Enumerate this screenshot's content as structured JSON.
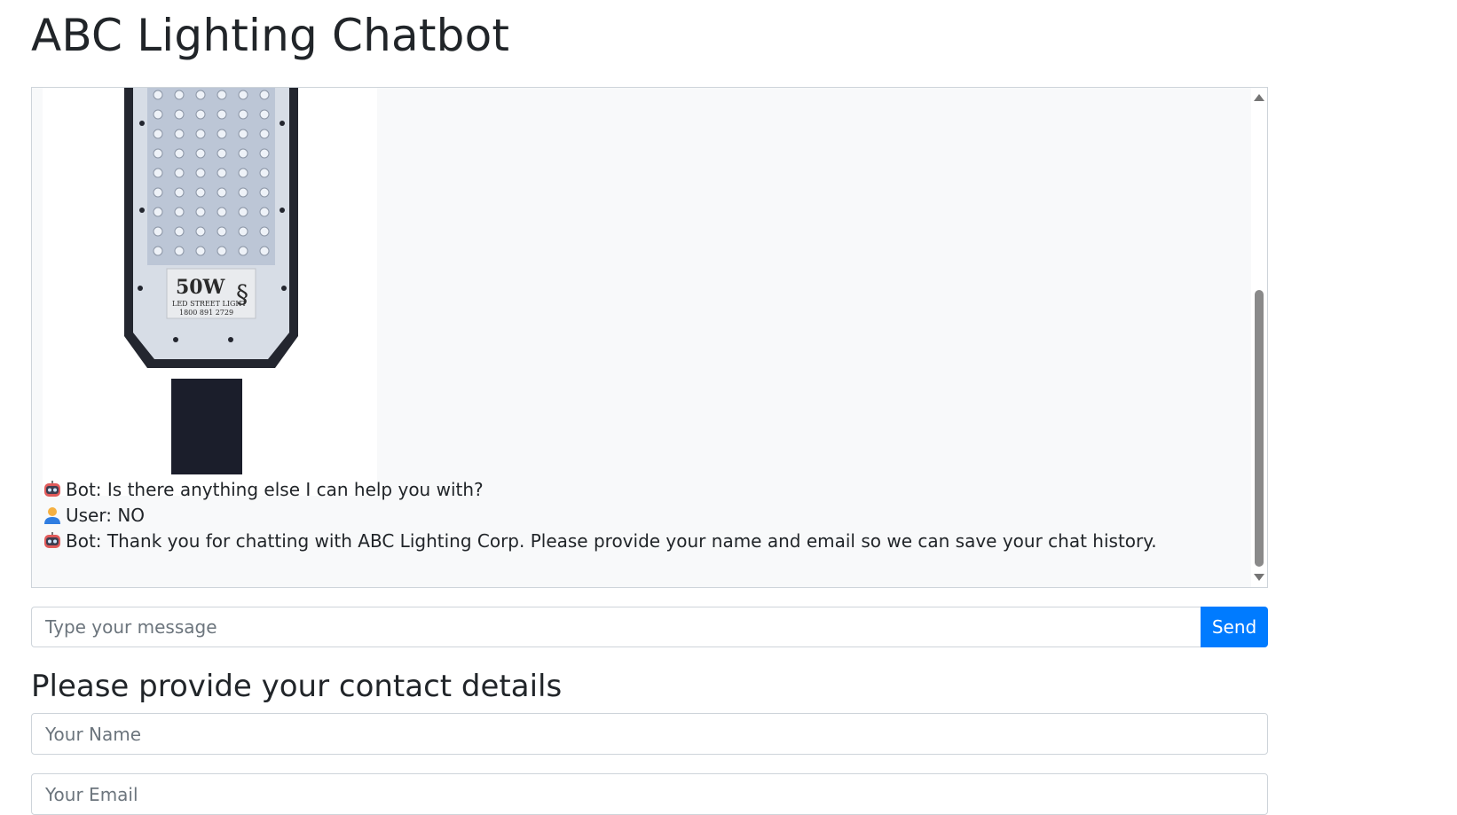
{
  "app": {
    "title": "ABC Lighting Chatbot"
  },
  "chat": {
    "product_image": {
      "label_main": "50W",
      "label_sub": "LED STREET LIGHT",
      "label_phone": "1800 891 2729"
    },
    "messages": [
      {
        "role": "bot",
        "avatar": "robot-icon",
        "text": "Bot: Is there anything else I can help you with?"
      },
      {
        "role": "user",
        "avatar": "person-icon",
        "text": "User: NO"
      },
      {
        "role": "bot",
        "avatar": "robot-icon",
        "text": "Bot: Thank you for chatting with ABC Lighting Corp. Please provide your name and email so we can save your chat history."
      }
    ]
  },
  "composer": {
    "placeholder": "Type your message",
    "send_label": "Send"
  },
  "contact": {
    "heading": "Please provide your contact details",
    "name_placeholder": "Your Name",
    "email_placeholder": "Your Email"
  },
  "colors": {
    "primary": "#007bff",
    "chat_bg": "#f8f9fa",
    "border": "#ced4da"
  }
}
